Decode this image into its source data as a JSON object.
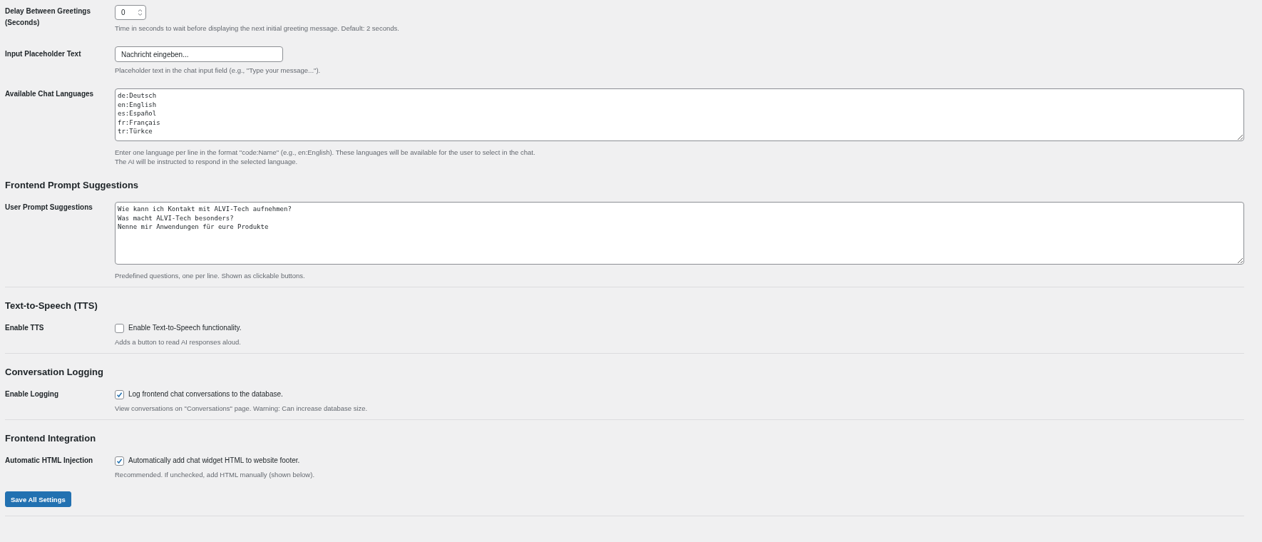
{
  "sections": [
    {
      "separated": false,
      "rows": [
        {
          "kind": "number",
          "label": "Delay Between Greetings (Seconds)",
          "value": "0",
          "description": [
            "Time in seconds to wait before displaying the next initial greeting message. Default: 2 seconds."
          ]
        },
        {
          "kind": "text",
          "label": "Input Placeholder Text",
          "value": "Nachricht eingeben...",
          "description": [
            "Placeholder text in the chat input field (e.g., \"Type your message...\")."
          ]
        },
        {
          "kind": "textarea",
          "label": "Available Chat Languages",
          "value": "de:Deutsch\nen:English\nes:Español\nfr:Français\ntr:Türkce",
          "description": [
            "Enter one language per line in the format \"code:Name\" (e.g., en:English). These languages will be available for the user to select in the chat.",
            "The AI will be instructed to respond in the selected language."
          ]
        }
      ]
    },
    {
      "separated": false,
      "heading": "Frontend Prompt Suggestions",
      "rows": [
        {
          "kind": "textarea",
          "label": "User Prompt Suggestions",
          "value": "Wie kann ich Kontakt mit ALVI-Tech aufnehmen?\nWas macht ALVI-Tech besonders?\nNenne mir Anwendungen für eure Produkte",
          "description": [
            "Predefined questions, one per line. Shown as clickable buttons."
          ]
        }
      ]
    },
    {
      "separated": true,
      "heading": "Text-to-Speech (TTS)",
      "rows": [
        {
          "kind": "checkbox",
          "label": "Enable TTS",
          "checked": false,
          "option": "Enable Text-to-Speech functionality.",
          "description": [
            "Adds a button to read AI responses aloud."
          ]
        }
      ]
    },
    {
      "separated": true,
      "heading": "Conversation Logging",
      "rows": [
        {
          "kind": "checkbox",
          "label": "Enable Logging",
          "checked": true,
          "option": "Log frontend chat conversations to the database.",
          "description": [
            "View conversations on \"Conversations\" page. Warning: Can increase database size."
          ]
        }
      ]
    },
    {
      "separated": true,
      "heading": "Frontend Integration",
      "rows": [
        {
          "kind": "checkbox",
          "label": "Automatic HTML Injection",
          "checked": true,
          "option": "Automatically add chat widget HTML to website footer.",
          "description": [
            "Recommended. If unchecked, add HTML manually (shown below)."
          ]
        }
      ]
    }
  ],
  "save_button": "Save All Settings"
}
